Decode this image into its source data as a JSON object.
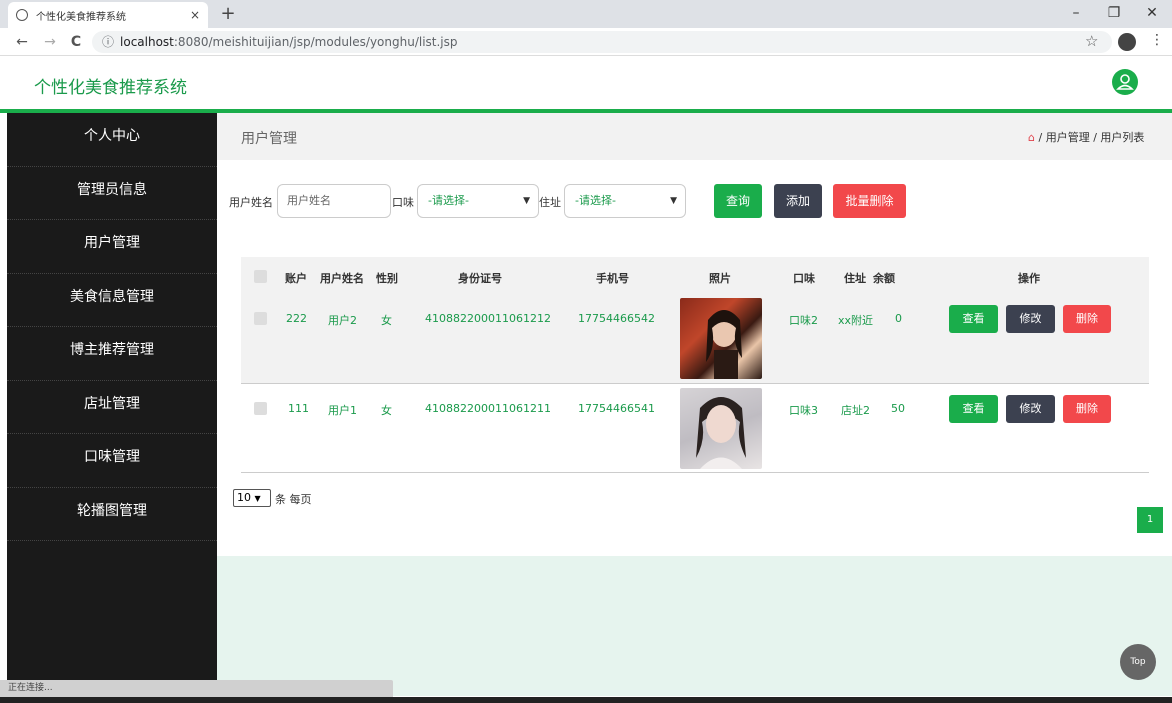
{
  "browser": {
    "tab_title": "个性化美食推荐系统",
    "tab_close": "×",
    "new_tab": "+",
    "url_host": "localhost",
    "url_path": ":8080/meishituijian/jsp/modules/yonghu/list.jsp",
    "minimize": "–",
    "restore": "❐",
    "close": "✕",
    "back": "←",
    "forward": "→",
    "reload": "C",
    "info": "ⓘ",
    "star": "☆",
    "more": "⋮"
  },
  "header": {
    "brand": "个性化美食推荐系统",
    "avatar_glyph": "ᴥ"
  },
  "sidebar": {
    "items": [
      {
        "label": "个人中心"
      },
      {
        "label": "管理员信息"
      },
      {
        "label": "用户管理"
      },
      {
        "label": "美食信息管理"
      },
      {
        "label": "博主推荐管理"
      },
      {
        "label": "店址管理"
      },
      {
        "label": "口味管理"
      },
      {
        "label": "轮播图管理"
      }
    ]
  },
  "breadcrumb": {
    "page_title": "用户管理",
    "home_icon": "⌂",
    "sep": "/",
    "level1": "用户管理",
    "level2": "用户列表"
  },
  "search": {
    "name_label": "用户姓名",
    "name_placeholder": "用户姓名",
    "taste_label": "口味",
    "taste_value": "-请选择-",
    "address_label": "住址",
    "address_value": "-请选择-",
    "query_button": "查询",
    "add_button": "添加",
    "batch_delete_button": "批量删除",
    "colors": {
      "query": "#1aad4b",
      "add": "#3c4150",
      "delete": "#f2484b"
    }
  },
  "table": {
    "headers": [
      "账户",
      "用户姓名",
      "性别",
      "身份证号",
      "手机号",
      "照片",
      "口味",
      "住址",
      "余额",
      "操作"
    ],
    "rows": [
      {
        "account": "222",
        "name": "用户2",
        "gender": "女",
        "id_number": "410882200011061212",
        "phone": "17754466542",
        "taste": "口味2",
        "address": "xx附近",
        "balance": "0",
        "photo": "portrait-1"
      },
      {
        "account": "111",
        "name": "用户1",
        "gender": "女",
        "id_number": "410882200011061211",
        "phone": "17754466541",
        "taste": "口味3",
        "address": "店址2",
        "balance": "50",
        "photo": "portrait-2"
      }
    ],
    "actions": {
      "view": "查看",
      "edit": "修改",
      "delete": "删除"
    }
  },
  "pagination": {
    "page_size": "10",
    "page_size_label": "条 每页",
    "current_page": "1"
  },
  "misc": {
    "top_button": "Top",
    "status_text": "正在连接..."
  }
}
